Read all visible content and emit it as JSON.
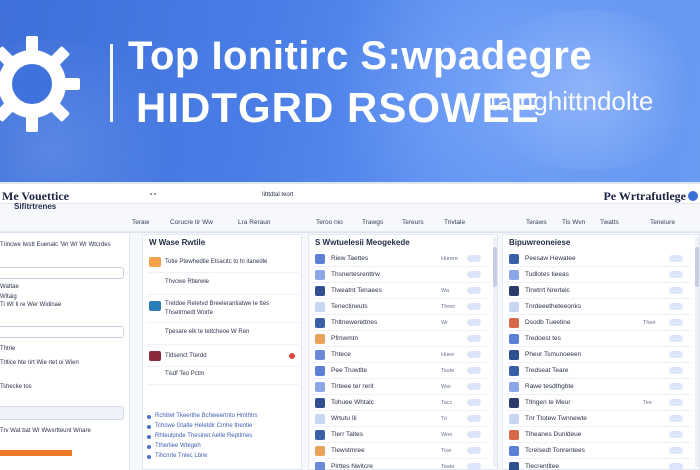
{
  "colors": {
    "banner": "#4a7ee6",
    "accent": "#3a6fd8",
    "orange": "#f07a2a",
    "text": "#1f2a44"
  },
  "banner": {
    "line1": "Top Ionitirc S:wpadegre",
    "line2": "HIDTGRD RSOWEE",
    "line3": "tamghittndolte",
    "logo_icon": "gear-icon"
  },
  "topbar": {
    "brand": "Me Vouettice",
    "brand_sub": "Sifitrtrenes",
    "center": "Iitttdtal teort",
    "brand_right": "Pe Wrtrafutlege"
  },
  "nav": [
    "Teraw",
    "Corucre  tir  Ww",
    "Lra  Reraun",
    "Teroo  nio",
    "Trawgs",
    "Tereurs",
    "Trivtale",
    "Teraws",
    "Tis  Wvn",
    "Twatts",
    "Teneiure"
  ],
  "left": {
    "rows": [
      "Trincwe  Iwstt Euenalc  'Wr  Wr Wr  Wtcrdes",
      "Wattae",
      "Wltaig",
      "Ti  Wt Ii   re  Wer Widinae",
      "Thtrie",
      "Trltice  hte rirt  Wie rtet oi Wien",
      "Tshecke tos",
      "Trv  Wat bat  Wr  Wwsrtteunt  Wnare"
    ]
  },
  "middle": {
    "title": "W   Wase  Rwtile",
    "items": [
      "Totie Ptewhedtie Etsacitc to  hi itanedle",
      "Thvcwe  Rtlerwie",
      "Tretdoe  Retetvd  Breelerantiatwe  Ie ttes",
      "Thsetrmedt  Worte",
      "Tpesare  elk te tettcheoe  W Ren",
      "Tldsenct  Tterdd",
      "Tisdf  Teo Pctm",
      "Rchtiwt  Tkeerthe  Bchweertnto  Hmthtrs",
      "Tchswe  Gtalte  Heletdir  Cmhe  thentie",
      "Rhteulpnde  Thesinet  Aetle  Reptlmes",
      "Ttherliee  Wtegeh",
      "Tihcnrte  Tnlec  Lbrw"
    ]
  },
  "col3": {
    "title": "S  Wwtuelesii  Meogekede",
    "rows": [
      {
        "text": "Riew Taettes",
        "meta": "Hurere"
      },
      {
        "text": "Thsnertesrenttrw",
        "meta": ""
      },
      {
        "text": "Tlweatnt   Tenaees",
        "meta": "Wa"
      },
      {
        "text": "Tenectineuts",
        "meta": "Thren"
      },
      {
        "text": "Thltnewerettnes",
        "meta": "Wr"
      },
      {
        "text": "Pfmwmtn",
        "meta": ""
      },
      {
        "text": "Thtece",
        "meta": "Huee"
      },
      {
        "text": "Pee Truwtlte",
        "meta": "Tsute"
      },
      {
        "text": "Tlrteee  ter rerit",
        "meta": "Wer"
      },
      {
        "text": "Tohuee  Whtalc",
        "meta": "Tacc"
      },
      {
        "text": "Wrtutu   Ili",
        "meta": "Tri"
      },
      {
        "text": "Tlerr  Taltes",
        "meta": "Woo"
      },
      {
        "text": "Tlewstmree",
        "meta": "Tioe"
      },
      {
        "text": "Plrttes   Nwitcre",
        "meta": "Teate"
      }
    ]
  },
  "col4": {
    "title": "Bipuwreoneiese",
    "rows": [
      {
        "text": "Peesaw  Hewatee",
        "meta": ""
      },
      {
        "text": "Tudlotes  tieeas",
        "meta": ""
      },
      {
        "text": "Tlrwtrrt  Nrertelc",
        "meta": ""
      },
      {
        "text": "Tnrdeeetheteeonks",
        "meta": ""
      },
      {
        "text": "Dsodb  Tueetine",
        "meta": "Thee"
      },
      {
        "text": "Tredoest tes",
        "meta": ""
      },
      {
        "text": "Pheur Tsmunoeeen",
        "meta": ""
      },
      {
        "text": "Tredseat  Teare",
        "meta": ""
      },
      {
        "text": "Rawe  tesdthgbte",
        "meta": ""
      },
      {
        "text": "Ttlngen  te   Meur",
        "meta": "Tee"
      },
      {
        "text": "Tnr   Ttotew  Twnnewte",
        "meta": ""
      },
      {
        "text": "Tlheanes  Dunldeue",
        "meta": ""
      },
      {
        "text": "Tcrelsedt   Tonrentees",
        "meta": ""
      },
      {
        "text": "Tlecrentltee",
        "meta": ""
      }
    ]
  }
}
